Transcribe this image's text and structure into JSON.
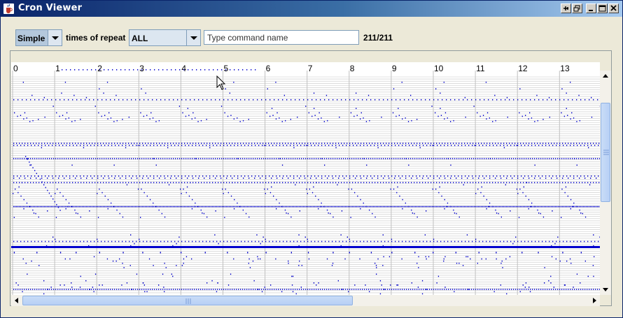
{
  "window": {
    "title": "Cron Viewer",
    "title_icon": "java-cup-icon",
    "controls": [
      "pin-icon",
      "restore-icon",
      "minimize-icon",
      "maximize-icon",
      "close-icon"
    ]
  },
  "toolbar": {
    "mode_value": "Simple",
    "repeat_label": "times of repeat",
    "repeat_value": "ALL",
    "search_placeholder": "Type command name",
    "count": "211/211"
  },
  "timeline": {
    "hour_labels": [
      "0",
      "1",
      "2",
      "3",
      "4",
      "5",
      "6",
      "7",
      "8",
      "9",
      "10",
      "11",
      "12",
      "13"
    ],
    "event_color": "#0000cc",
    "gridline_color": "#c0c0c0"
  },
  "colors": {
    "titlebar_start": "#0a246a",
    "titlebar_end": "#a6caf0",
    "window_bg": "#ece9d8",
    "scroll_thumb": "#b7d0f5"
  }
}
